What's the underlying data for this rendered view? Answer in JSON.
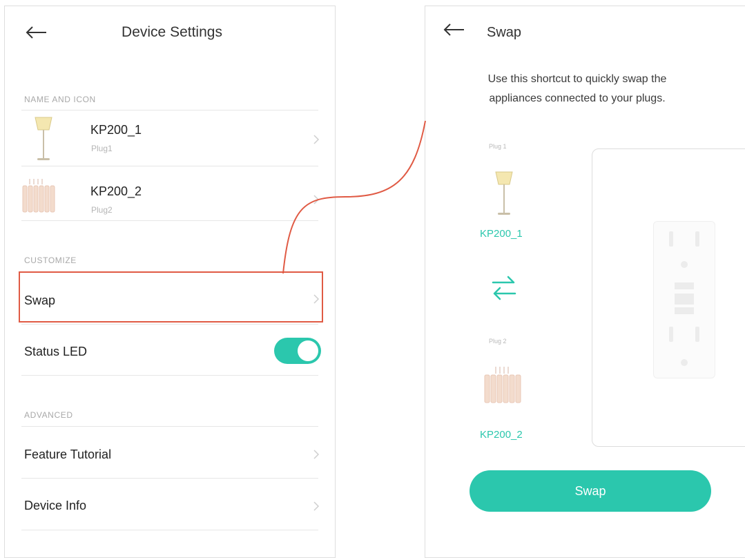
{
  "left_screen": {
    "title": "Device Settings",
    "sections": {
      "name_and_icon": "NAME AND ICON",
      "customize": "CUSTOMIZE",
      "advanced": "ADVANCED"
    },
    "devices": [
      {
        "name": "KP200_1",
        "plug": "Plug1",
        "icon": "floor-lamp-icon"
      },
      {
        "name": "KP200_2",
        "plug": "Plug2",
        "icon": "radiator-heater-icon"
      }
    ],
    "swap_label": "Swap",
    "status_led_label": "Status LED",
    "status_led_on": true,
    "feature_tutorial_label": "Feature Tutorial",
    "device_info_label": "Device Info"
  },
  "right_screen": {
    "title": "Swap",
    "description": "Use this shortcut to quickly swap the appliances connected to your plugs.",
    "plug1_label": "Plug 1",
    "plug1_name": "KP200_1",
    "plug2_label": "Plug 2",
    "plug2_name": "KP200_2",
    "swap_button": "Swap"
  },
  "colors": {
    "accent": "#2bc7ad",
    "highlight": "#e05a44"
  }
}
